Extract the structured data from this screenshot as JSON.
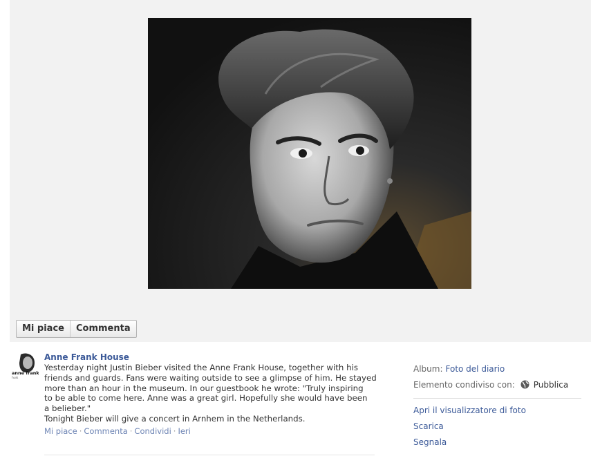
{
  "photo": {
    "alt": "Foto"
  },
  "actions": {
    "like_label": "Mi piace",
    "comment_label": "Commenta"
  },
  "post": {
    "avatar_text_1": "anne frank",
    "avatar_text_2": "huis",
    "author": "Anne Frank House",
    "text": "Yesterday night Justin Bieber visited the Anne Frank House, together with his\nfriends and guards. Fans were waiting outside to see a glimpse of him. He stayed\nmore than an hour in the museum. In our guestbook he wrote: \"Truly inspiring\nto be able to come here. Anne was a great girl. Hopefully she would have been\na belieber.\"\nTonight Bieber will give a concert in Arnhem in the Netherlands.",
    "like_link": "Mi piace",
    "comment_link": "Commenta",
    "share_link": "Condividi",
    "timestamp": "Ieri",
    "separator": "·"
  },
  "sidebar": {
    "album_label": "Album:",
    "album_value": "Foto del diario",
    "shared_label": "Elemento condiviso con:",
    "shared_value": "Pubblica",
    "links": [
      "Apri il visualizzatore di foto",
      "Scarica",
      "Segnala"
    ]
  },
  "colors": {
    "link_blue": "#3b5998",
    "light_link": "#6d84b4",
    "stage_bg": "#f2f2f2"
  },
  "icons": {
    "globe": "globe-icon"
  }
}
